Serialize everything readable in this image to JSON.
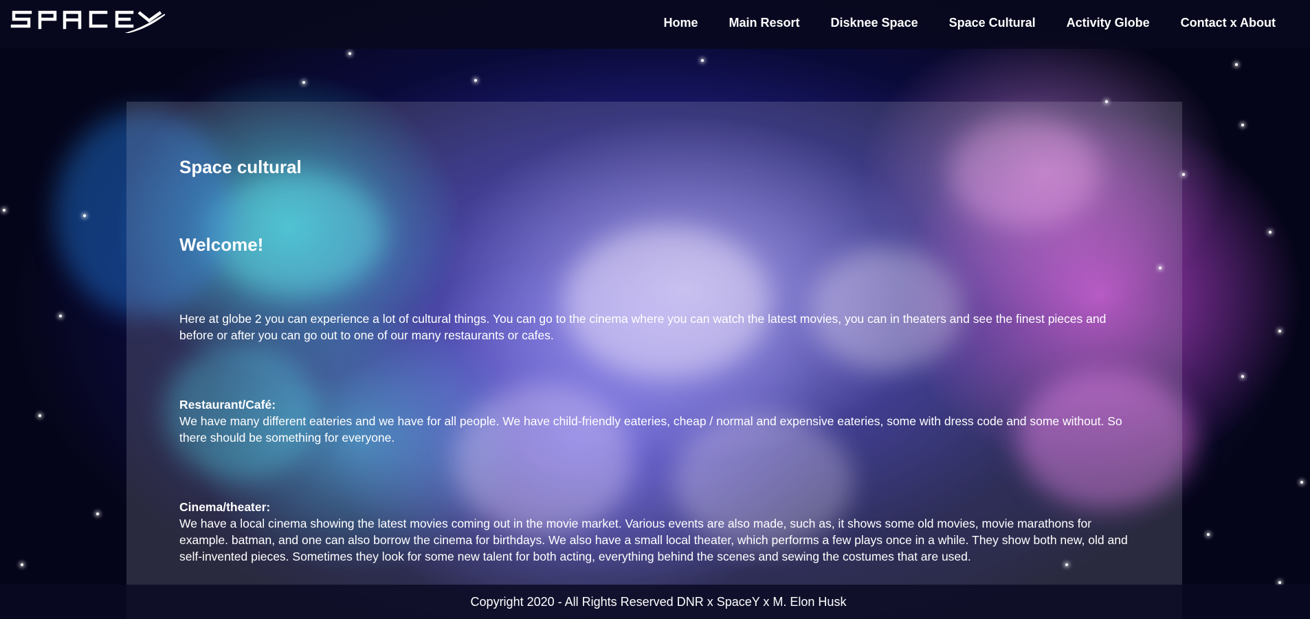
{
  "header": {
    "logo_text": "SPACEY",
    "nav": [
      {
        "label": "Home"
      },
      {
        "label": "Main Resort"
      },
      {
        "label": "Disknee Space"
      },
      {
        "label": "Space Cultural"
      },
      {
        "label": "Activity Globe"
      },
      {
        "label": "Contact x About"
      }
    ]
  },
  "main": {
    "title": "Space cultural",
    "welcome": "Welcome!",
    "intro": "Here at globe 2 you can experience a lot of cultural things. You can go to the cinema where you can watch the latest movies, you can in theaters and see the finest pieces and before or after you can go out to one of our many restaurants or cafes.",
    "sections": [
      {
        "heading": "Restaurant/Café:",
        "text": "We have many different eateries and we have for all people. We have child-friendly eateries, cheap / normal and expensive eateries, some with dress code and some without. So there should be something for everyone."
      },
      {
        "heading": "Cinema/theater:",
        "text": "We have a local cinema showing the latest movies coming out in the movie market. Various events are also made, such as, it shows some old movies, movie marathons for example. batman, and one can also borrow the cinema for birthdays. We also have a small local theater, which performs a few plays once in a while. They show both new, old and self-invented pieces. Sometimes they look for some new talent for both acting, everything behind the scenes and sewing the costumes that are used."
      }
    ]
  },
  "footer": {
    "copyright": "Copyright 2020 - All Rights Reserved DNR x SpaceY x M. Elon Husk"
  },
  "colors": {
    "header_bg": "#08081e",
    "text": "#ffffff",
    "nebula_blue": "#4638e6",
    "nebula_cyan": "#28dce6",
    "nebula_pink": "#e650e6"
  }
}
